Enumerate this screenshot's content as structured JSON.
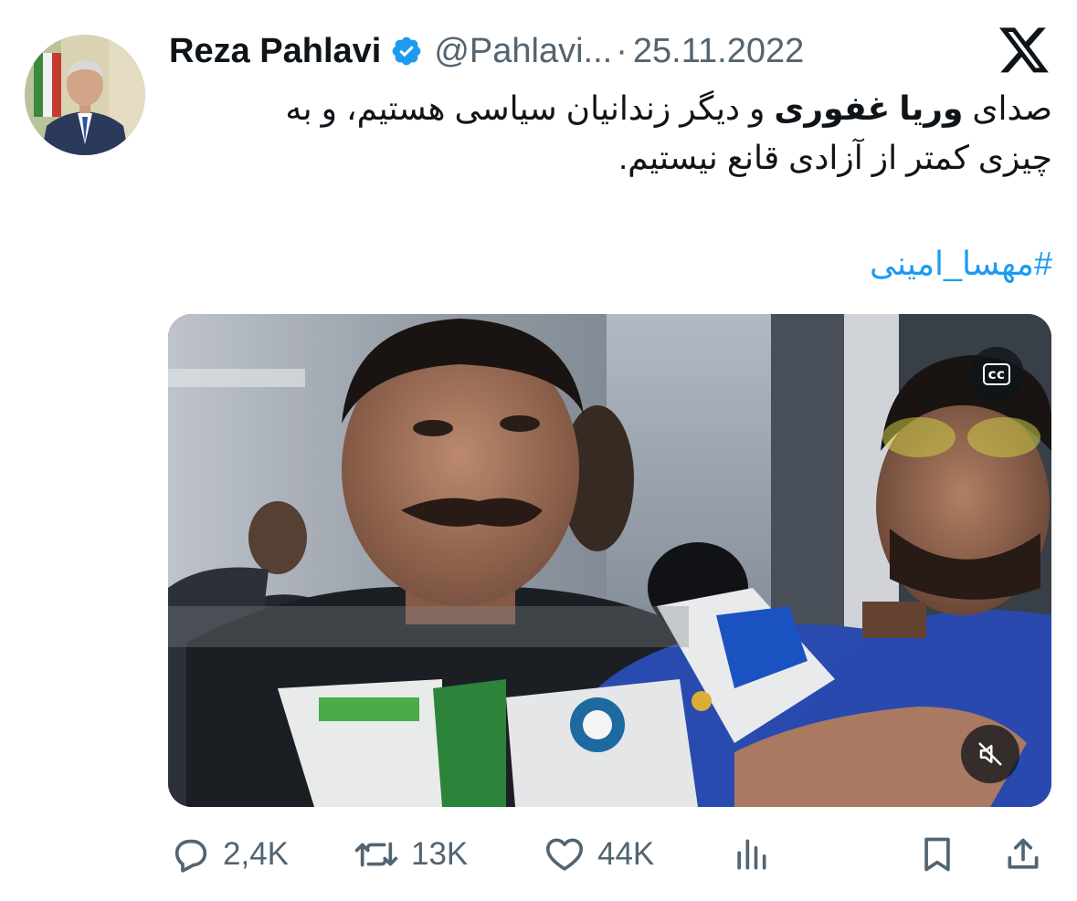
{
  "author": {
    "display_name": "Reza Pahlavi",
    "handle": "@Pahlavi...",
    "separator": "·",
    "date": "25.11.2022",
    "verified": true
  },
  "tweet": {
    "line1_prefix": "صدای ",
    "line1_bold": "وریا غفوری",
    "line1_suffix": " و دیگر زندانیان سیاسی هستیم، و به",
    "line2": "چیزی کمتر از آزادی قانع نیستیم.",
    "hashtag": "#مهسا_امینی"
  },
  "media": {
    "cc_label": "cc",
    "mute_icon": "speaker-muted-icon"
  },
  "actions": {
    "reply_count": "2,4K",
    "retweet_count": "13K",
    "like_count": "44K",
    "views_icon": "bar-chart-icon",
    "bookmark_icon": "bookmark-icon",
    "share_icon": "share-icon"
  },
  "colors": {
    "text": "#0f1419",
    "secondary": "#536471",
    "link": "#1d9bf0",
    "verified": "#1d9bf0"
  }
}
